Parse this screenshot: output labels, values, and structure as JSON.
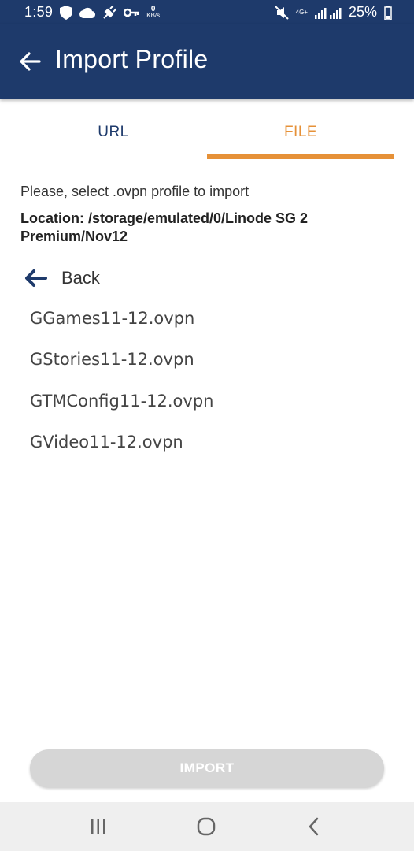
{
  "status_bar": {
    "time": "1:59",
    "kbs_value": "0",
    "kbs_unit": "KB/s",
    "network_label": "4G+",
    "battery_percent": "25%",
    "icons": [
      "shield-icon",
      "cloud-icon",
      "vpn-key-plug-icon",
      "key-icon",
      "mute-icon",
      "signal-icon",
      "battery-icon"
    ]
  },
  "app_bar": {
    "title": "Import Profile",
    "back_icon": "arrow-left-icon"
  },
  "tabs": [
    {
      "label": "URL",
      "selected": false
    },
    {
      "label": "FILE",
      "selected": true
    }
  ],
  "content": {
    "instruction": "Please, select .ovpn profile to import",
    "location": "Location: /storage/emulated/0/Linode SG 2 Premium/Nov12",
    "back_label": "Back",
    "files": [
      "GGames11-12.ovpn",
      "GStories11-12.ovpn",
      "GTMConfig11-12.ovpn",
      "GVideo11-12.ovpn"
    ]
  },
  "import_button": {
    "label": "IMPORT",
    "enabled": false
  },
  "colors": {
    "primary": "#1e3a6b",
    "accent": "#e69138",
    "disabled_button": "#d6d6d6",
    "nav_bar": "#efefef"
  }
}
